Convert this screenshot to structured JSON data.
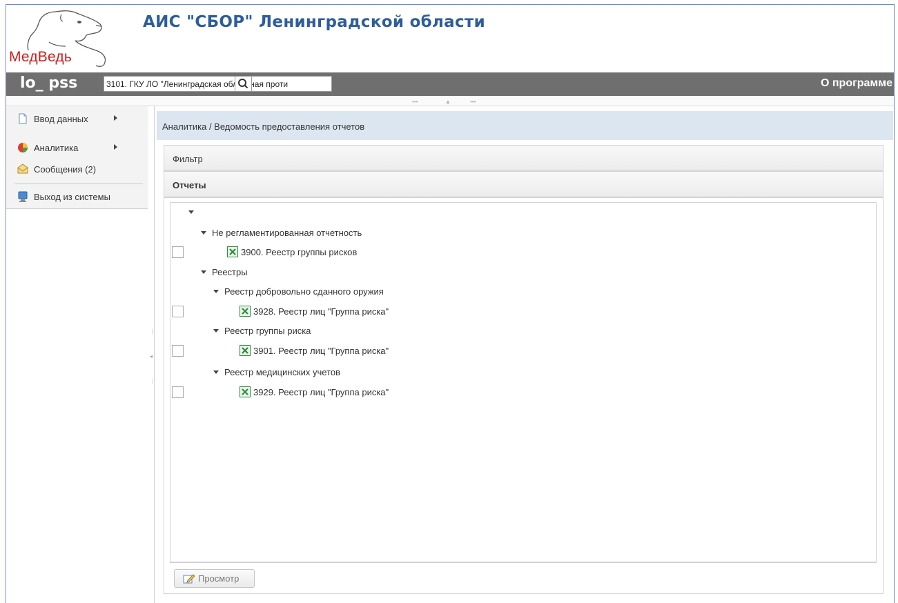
{
  "header": {
    "logo_text": "МедВедь",
    "app_title": "АИС \"СБОР\" Ленинградской области"
  },
  "toolbar": {
    "username": "lo_ pss",
    "org_search_value": "3101. ГКУ ЛО \"Ленинградская областная проти",
    "about_label": "О программе"
  },
  "sidebar": {
    "items": [
      {
        "label": "Ввод данных",
        "icon": "document-icon",
        "has_submenu": true
      },
      {
        "label": "Аналитика",
        "icon": "pie-chart-icon",
        "has_submenu": true
      },
      {
        "label": "Сообщения (2)",
        "icon": "envelope-icon",
        "has_submenu": false
      },
      {
        "label": "Выход из системы",
        "icon": "monitor-icon",
        "has_submenu": false
      }
    ]
  },
  "main": {
    "breadcrumb": "Аналитика / Ведомость предоставления отчетов",
    "filter_label": "Фильтр",
    "reports_label": "Отчеты",
    "tree": {
      "root": "",
      "groups": [
        {
          "label": "Не регламентированная отчетность"
        },
        {
          "label": "Реестры"
        },
        {
          "label": "Реестр добровольно сданного оружия"
        },
        {
          "label": "Реестр группы риска"
        },
        {
          "label": "Реестр медицинских учетов"
        }
      ],
      "reports": [
        {
          "label": "3900. Реестр группы рисков",
          "checked": false
        },
        {
          "label": "3928. Реестр лиц \"Группа риска\"",
          "checked": false
        },
        {
          "label": "3901. Реестр лиц \"Группа риска\"",
          "checked": false
        },
        {
          "label": "3929. Реестр лиц \"Группа риска\"",
          "checked": false
        }
      ]
    },
    "view_button_label": "Просмотр"
  },
  "colors": {
    "title_blue": "#2e5d9a",
    "toolbar_gray": "#6f6f6f",
    "breadcrumb_bg": "#dce6f0",
    "logo_red": "#d01b1b",
    "excel_green": "#2e8b3a"
  }
}
